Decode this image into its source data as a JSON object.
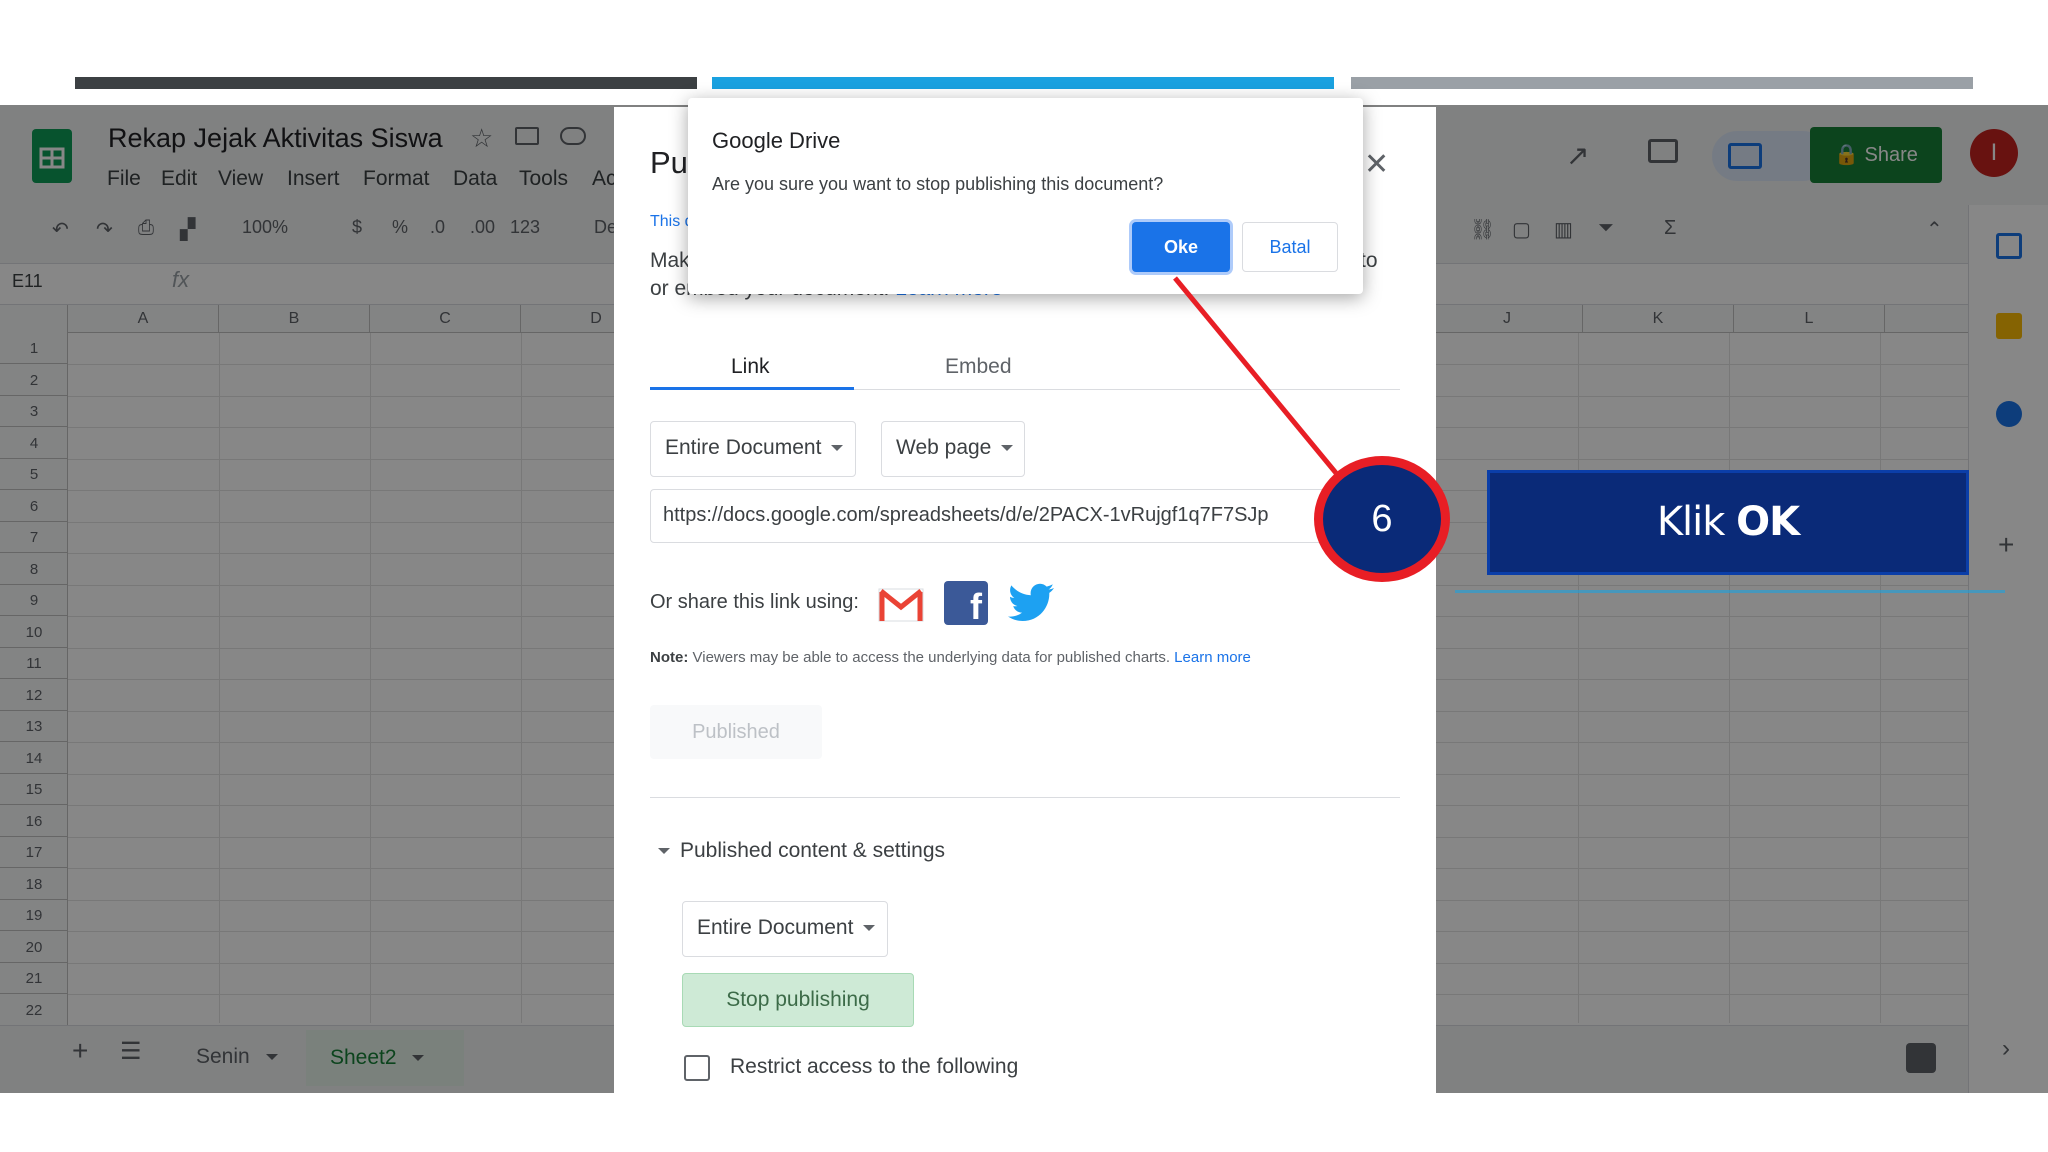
{
  "spreadsheet": {
    "title": "Rekap Jejak Aktivitas Siswa",
    "menu": [
      "File",
      "Edit",
      "View",
      "Insert",
      "Format",
      "Data",
      "Tools",
      "Ac"
    ],
    "share_label": "Share",
    "avatar_letter": "I",
    "toolbar": {
      "zoom": "100%",
      "currency": "$",
      "percent": "%",
      "dec_less": ".0",
      "dec_more": ".00",
      "format": "123",
      "font": "De"
    },
    "cell_ref": "E11",
    "fx": "fx",
    "columns_left": [
      "A",
      "B",
      "C",
      "D"
    ],
    "columns_right": [
      "J",
      "K",
      "L"
    ],
    "rows": [
      "1",
      "2",
      "3",
      "4",
      "5",
      "6",
      "7",
      "8",
      "9",
      "10",
      "11",
      "12",
      "13",
      "14",
      "15",
      "16",
      "17",
      "18",
      "19",
      "20",
      "21",
      "22"
    ],
    "sheets": [
      "Senin",
      "Sheet2"
    ]
  },
  "publish_dialog": {
    "title_partial": "Pu",
    "info_partial": "This d",
    "desc_line1_left": "Mak",
    "desc_line1_right": "to",
    "desc_line2": "or embed your document.",
    "desc_learn_more": "Learn more",
    "tabs": [
      "Link",
      "Embed"
    ],
    "dropdown_scope": "Entire Document",
    "dropdown_format": "Web page",
    "url": "https://docs.google.com/spreadsheets/d/e/2PACX-1vRujgf1q7F7SJp",
    "share_label": "Or share this link using:",
    "note_label": "Note:",
    "note_text": "Viewers may be able to access the underlying data for published charts.",
    "note_learn_more": "Learn more",
    "published_button": "Published",
    "section_title": "Published content & settings",
    "section_dropdown": "Entire Document",
    "stop_publishing": "Stop publishing",
    "restrict_label": "Restrict access to the following"
  },
  "alert": {
    "title": "Google Drive",
    "message": "Are you sure you want to stop publishing this document?",
    "ok": "Oke",
    "cancel": "Batal"
  },
  "annotation": {
    "step": "6",
    "label_prefix": "Klik",
    "label_bold": "OK"
  },
  "colors": {
    "accent_blue": "#1a73e8",
    "share_green": "#188038",
    "annotation_navy": "#0a2a78",
    "annotation_red": "#e81e25",
    "stop_button_bg": "#ceead6"
  }
}
